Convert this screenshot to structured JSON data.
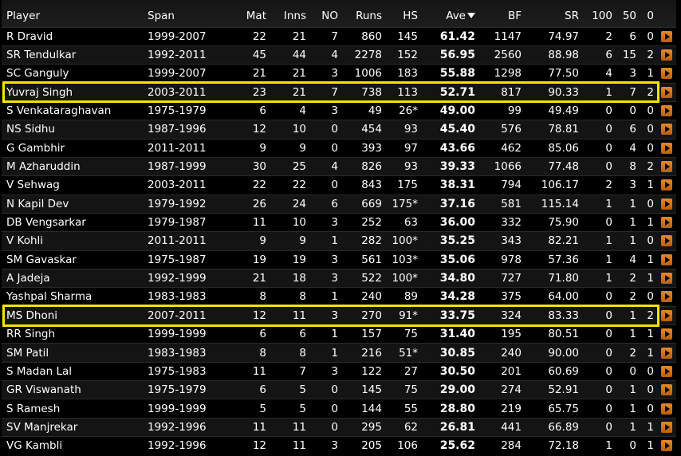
{
  "table": {
    "columns": [
      {
        "key": "player",
        "label": "Player"
      },
      {
        "key": "span",
        "label": "Span"
      },
      {
        "key": "mat",
        "label": "Mat"
      },
      {
        "key": "inns",
        "label": "Inns"
      },
      {
        "key": "no",
        "label": "NO"
      },
      {
        "key": "runs",
        "label": "Runs"
      },
      {
        "key": "hs",
        "label": "HS"
      },
      {
        "key": "ave",
        "label": "Ave"
      },
      {
        "key": "bf",
        "label": "BF"
      },
      {
        "key": "sr",
        "label": "SR"
      },
      {
        "key": "c100",
        "label": "100"
      },
      {
        "key": "c50",
        "label": "50"
      },
      {
        "key": "c0",
        "label": "0"
      }
    ],
    "sort_column": "ave",
    "sort_direction": "desc",
    "rows": [
      {
        "player": "R Dravid",
        "span": "1999-2007",
        "mat": "22",
        "inns": "21",
        "no": "7",
        "runs": "860",
        "hs": "145",
        "ave": "61.42",
        "bf": "1147",
        "sr": "74.97",
        "c100": "2",
        "c50": "6",
        "c0": "0",
        "highlight": false
      },
      {
        "player": "SR Tendulkar",
        "span": "1992-2011",
        "mat": "45",
        "inns": "44",
        "no": "4",
        "runs": "2278",
        "hs": "152",
        "ave": "56.95",
        "bf": "2560",
        "sr": "88.98",
        "c100": "6",
        "c50": "15",
        "c0": "2",
        "highlight": false
      },
      {
        "player": "SC Ganguly",
        "span": "1999-2007",
        "mat": "21",
        "inns": "21",
        "no": "3",
        "runs": "1006",
        "hs": "183",
        "ave": "55.88",
        "bf": "1298",
        "sr": "77.50",
        "c100": "4",
        "c50": "3",
        "c0": "1",
        "highlight": false
      },
      {
        "player": "Yuvraj Singh",
        "span": "2003-2011",
        "mat": "23",
        "inns": "21",
        "no": "7",
        "runs": "738",
        "hs": "113",
        "ave": "52.71",
        "bf": "817",
        "sr": "90.33",
        "c100": "1",
        "c50": "7",
        "c0": "2",
        "highlight": true
      },
      {
        "player": "S Venkataraghavan",
        "span": "1975-1979",
        "mat": "6",
        "inns": "4",
        "no": "3",
        "runs": "49",
        "hs": "26*",
        "ave": "49.00",
        "bf": "99",
        "sr": "49.49",
        "c100": "0",
        "c50": "0",
        "c0": "0",
        "highlight": false
      },
      {
        "player": "NS Sidhu",
        "span": "1987-1996",
        "mat": "12",
        "inns": "10",
        "no": "0",
        "runs": "454",
        "hs": "93",
        "ave": "45.40",
        "bf": "576",
        "sr": "78.81",
        "c100": "0",
        "c50": "6",
        "c0": "0",
        "highlight": false
      },
      {
        "player": "G Gambhir",
        "span": "2011-2011",
        "mat": "9",
        "inns": "9",
        "no": "0",
        "runs": "393",
        "hs": "97",
        "ave": "43.66",
        "bf": "462",
        "sr": "85.06",
        "c100": "0",
        "c50": "4",
        "c0": "0",
        "highlight": false
      },
      {
        "player": "M Azharuddin",
        "span": "1987-1999",
        "mat": "30",
        "inns": "25",
        "no": "4",
        "runs": "826",
        "hs": "93",
        "ave": "39.33",
        "bf": "1066",
        "sr": "77.48",
        "c100": "0",
        "c50": "8",
        "c0": "2",
        "highlight": false
      },
      {
        "player": "V Sehwag",
        "span": "2003-2011",
        "mat": "22",
        "inns": "22",
        "no": "0",
        "runs": "843",
        "hs": "175",
        "ave": "38.31",
        "bf": "794",
        "sr": "106.17",
        "c100": "2",
        "c50": "3",
        "c0": "1",
        "highlight": false
      },
      {
        "player": "N Kapil Dev",
        "span": "1979-1992",
        "mat": "26",
        "inns": "24",
        "no": "6",
        "runs": "669",
        "hs": "175*",
        "ave": "37.16",
        "bf": "581",
        "sr": "115.14",
        "c100": "1",
        "c50": "1",
        "c0": "0",
        "highlight": false
      },
      {
        "player": "DB Vengsarkar",
        "span": "1979-1987",
        "mat": "11",
        "inns": "10",
        "no": "3",
        "runs": "252",
        "hs": "63",
        "ave": "36.00",
        "bf": "332",
        "sr": "75.90",
        "c100": "0",
        "c50": "1",
        "c0": "1",
        "highlight": false
      },
      {
        "player": "V Kohli",
        "span": "2011-2011",
        "mat": "9",
        "inns": "9",
        "no": "1",
        "runs": "282",
        "hs": "100*",
        "ave": "35.25",
        "bf": "343",
        "sr": "82.21",
        "c100": "1",
        "c50": "1",
        "c0": "0",
        "highlight": false
      },
      {
        "player": "SM Gavaskar",
        "span": "1975-1987",
        "mat": "19",
        "inns": "19",
        "no": "3",
        "runs": "561",
        "hs": "103*",
        "ave": "35.06",
        "bf": "978",
        "sr": "57.36",
        "c100": "1",
        "c50": "4",
        "c0": "1",
        "highlight": false
      },
      {
        "player": "A Jadeja",
        "span": "1992-1999",
        "mat": "21",
        "inns": "18",
        "no": "3",
        "runs": "522",
        "hs": "100*",
        "ave": "34.80",
        "bf": "727",
        "sr": "71.80",
        "c100": "1",
        "c50": "2",
        "c0": "1",
        "highlight": false
      },
      {
        "player": "Yashpal Sharma",
        "span": "1983-1983",
        "mat": "8",
        "inns": "8",
        "no": "1",
        "runs": "240",
        "hs": "89",
        "ave": "34.28",
        "bf": "375",
        "sr": "64.00",
        "c100": "0",
        "c50": "2",
        "c0": "0",
        "highlight": false
      },
      {
        "player": "MS Dhoni",
        "span": "2007-2011",
        "mat": "12",
        "inns": "11",
        "no": "3",
        "runs": "270",
        "hs": "91*",
        "ave": "33.75",
        "bf": "324",
        "sr": "83.33",
        "c100": "0",
        "c50": "1",
        "c0": "2",
        "highlight": true
      },
      {
        "player": "RR Singh",
        "span": "1999-1999",
        "mat": "6",
        "inns": "6",
        "no": "1",
        "runs": "157",
        "hs": "75",
        "ave": "31.40",
        "bf": "195",
        "sr": "80.51",
        "c100": "0",
        "c50": "1",
        "c0": "1",
        "highlight": false
      },
      {
        "player": "SM Patil",
        "span": "1983-1983",
        "mat": "8",
        "inns": "8",
        "no": "1",
        "runs": "216",
        "hs": "51*",
        "ave": "30.85",
        "bf": "240",
        "sr": "90.00",
        "c100": "0",
        "c50": "2",
        "c0": "1",
        "highlight": false
      },
      {
        "player": "S Madan Lal",
        "span": "1975-1983",
        "mat": "11",
        "inns": "7",
        "no": "3",
        "runs": "122",
        "hs": "27",
        "ave": "30.50",
        "bf": "201",
        "sr": "60.69",
        "c100": "0",
        "c50": "0",
        "c0": "0",
        "highlight": false
      },
      {
        "player": "GR Viswanath",
        "span": "1975-1979",
        "mat": "6",
        "inns": "5",
        "no": "0",
        "runs": "145",
        "hs": "75",
        "ave": "29.00",
        "bf": "274",
        "sr": "52.91",
        "c100": "0",
        "c50": "1",
        "c0": "0",
        "highlight": false
      },
      {
        "player": "S Ramesh",
        "span": "1999-1999",
        "mat": "5",
        "inns": "5",
        "no": "0",
        "runs": "144",
        "hs": "55",
        "ave": "28.80",
        "bf": "219",
        "sr": "65.75",
        "c100": "0",
        "c50": "1",
        "c0": "0",
        "highlight": false
      },
      {
        "player": "SV Manjrekar",
        "span": "1992-1996",
        "mat": "11",
        "inns": "11",
        "no": "0",
        "runs": "295",
        "hs": "62",
        "ave": "26.81",
        "bf": "441",
        "sr": "66.89",
        "c100": "0",
        "c50": "1",
        "c0": "1",
        "highlight": false
      },
      {
        "player": "VG Kambli",
        "span": "1992-1996",
        "mat": "12",
        "inns": "11",
        "no": "3",
        "runs": "205",
        "hs": "106",
        "ave": "25.62",
        "bf": "284",
        "sr": "72.18",
        "c100": "1",
        "c50": "0",
        "c0": "1",
        "highlight": false
      }
    ]
  },
  "colors": {
    "highlight_border": "#f4e400",
    "play_button": "#e48a2c",
    "row_alt": "#141414",
    "background": "#000000"
  },
  "icons": {
    "sort": "sort-desc-triangle-icon",
    "row_action": "play-arrow-icon"
  }
}
